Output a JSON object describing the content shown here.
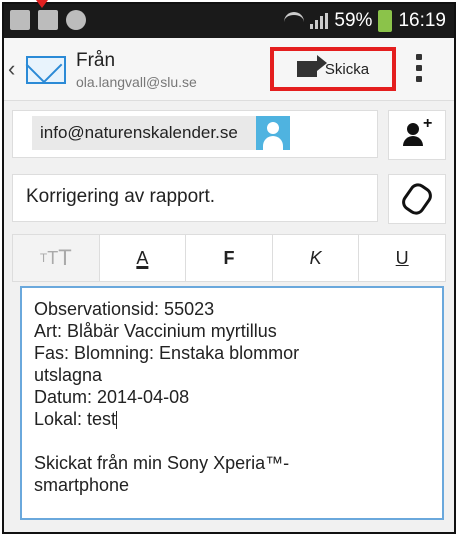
{
  "status_bar": {
    "notification_icons": [
      "image-icon",
      "mail-icon",
      "android-icon"
    ],
    "battery_percent": "59%",
    "time": "16:19"
  },
  "header": {
    "from_label": "Från",
    "from_email": "ola.langvall@slu.se",
    "send_label": "Skicka"
  },
  "compose": {
    "to_chip": "info@naturenskalender.se",
    "subject": "Korrigering av rapport."
  },
  "format_bar": {
    "size_small": "T",
    "size_mid": "T",
    "size_big": "T",
    "font_color": "A",
    "bold": "F",
    "italic": "K",
    "underline": "U"
  },
  "body_lines": [
    "Observationsid: 55023",
    "Art: Blåbär Vaccinium myrtillus",
    "Fas: Blomning: Enstaka blommor",
    "utslagna",
    "Datum: 2014-04-08",
    "Lokal: test",
    "",
    "Skickat från min Sony Xperia™-",
    "smartphone"
  ],
  "colors": {
    "highlight_red": "#e41e1e",
    "accent_blue": "#2b8ad6",
    "battery_green": "#8bc34a"
  }
}
